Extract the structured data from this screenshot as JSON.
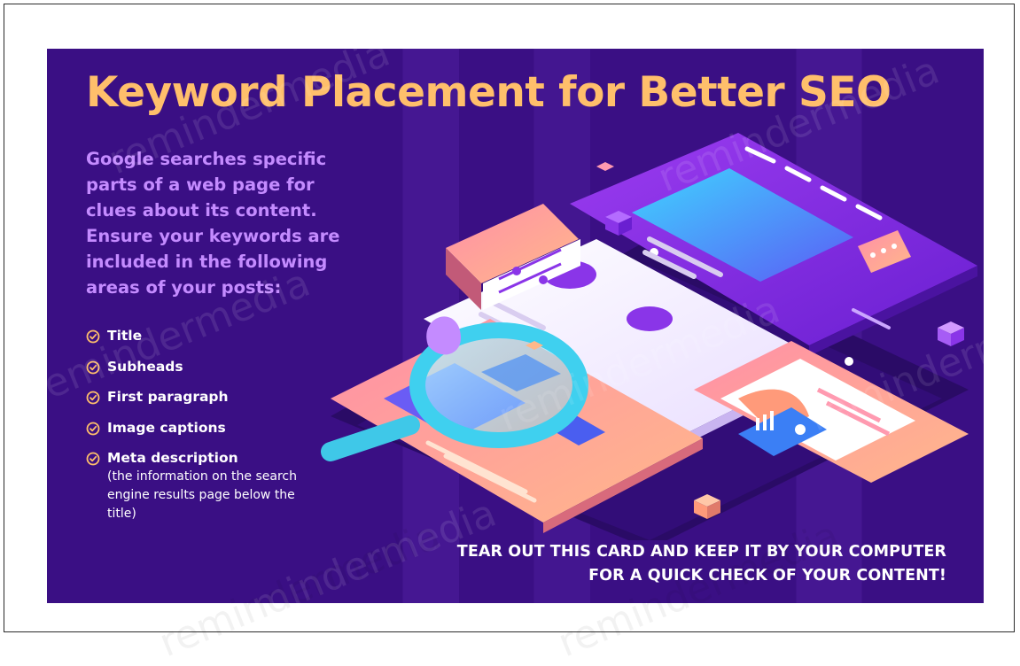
{
  "card": {
    "title": "Keyword Placement for Better SEO",
    "intro": "Google searches specific parts of a web page for clues about its content. Ensure your keywords are included in the following areas of your posts:",
    "checklist": [
      {
        "label": "Title"
      },
      {
        "label": "Subheads"
      },
      {
        "label": "First paragraph"
      },
      {
        "label": "Image captions"
      },
      {
        "label": "Meta description",
        "note": "(the information on the search engine results page below the title)"
      }
    ],
    "cta_line1": "TEAR OUT THIS CARD AND KEEP IT BY YOUR COMPUTER",
    "cta_line2": "FOR A QUICK CHECK OF YOUR CONTENT!"
  },
  "watermark": "remindermedia",
  "colors": {
    "background": "#3a0f84",
    "title": "#ffbf6b",
    "intro": "#c48bff",
    "check": "#ffbf6b",
    "text": "#ffffff"
  },
  "icons": [
    "check-circle-icon",
    "magnifying-glass-icon",
    "chat-bubble-icon",
    "slider-panel-icon",
    "chart-icon"
  ]
}
